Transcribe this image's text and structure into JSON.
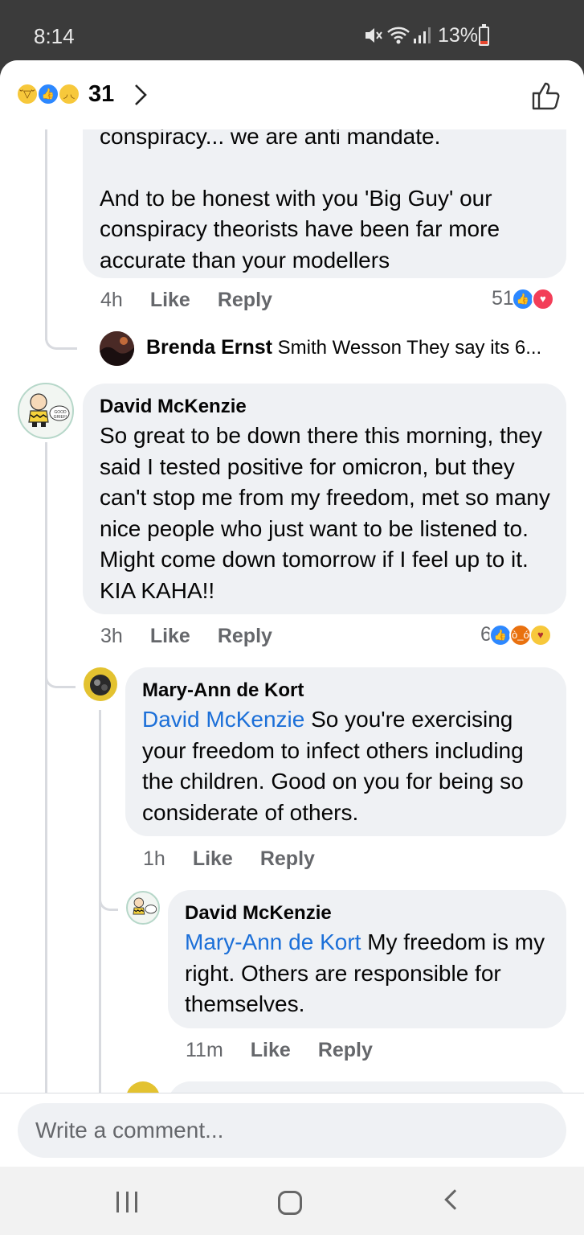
{
  "status": {
    "time": "8:14",
    "battery": "13%"
  },
  "reactions": {
    "count": "31"
  },
  "comments": [
    {
      "text_partial_top": "conspiracy... we are anti mandate.",
      "text": "And to be honest with you 'Big Guy' our conspiracy theorists have been far more accurate than your modellers",
      "time": "4h",
      "like": "Like",
      "reply": "Reply",
      "reaction_count": "51"
    },
    {
      "author": "David McKenzie",
      "text": "So great to be down there this morning, they said I tested positive for omicron, but they can't stop me from my freedom, met so many nice people who just want to be listened to. Might come down tomorrow if I feel up to it. KIA KAHA!!",
      "time": "3h",
      "like": "Like",
      "reply": "Reply",
      "reaction_count": "6"
    },
    {
      "author": "Mary-Ann de Kort",
      "mention": "David McKenzie",
      "text": " So you're exercising your freedom to infect others including the children. Good on you for being so considerate of others.",
      "time": "1h",
      "like": "Like",
      "reply": "Reply"
    },
    {
      "author": "David McKenzie",
      "mention": "Mary-Ann de Kort",
      "text": " My freedom is my right. Others are responsible for themselves.",
      "time": "11m",
      "like": "Like",
      "reply": "Reply"
    }
  ],
  "reply_preview": {
    "author": "Brenda Ernst",
    "text": "Smith Wesson They say its 6..."
  },
  "avatar_text": {
    "charlie": "GOOD GRIEF!"
  },
  "composer": {
    "placeholder": "Write a comment..."
  },
  "colors": {
    "accent": "#2d88ff",
    "mention": "#1b6fd8",
    "bubble": "#eff1f4"
  }
}
